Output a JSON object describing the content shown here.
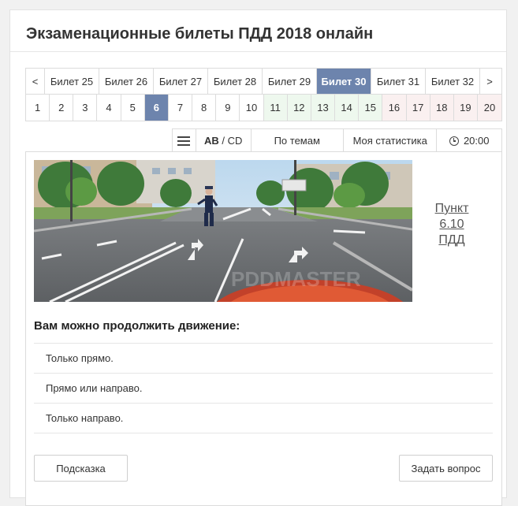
{
  "page": {
    "title": "Экзаменационные билеты ПДД 2018 онлайн"
  },
  "tickets": {
    "prev": "<",
    "next": ">",
    "items": [
      "Билет 25",
      "Билет 26",
      "Билет 27",
      "Билет 28",
      "Билет 29",
      "Билет 30",
      "Билет 31",
      "Билет 32"
    ],
    "active": "Билет 30"
  },
  "questions": {
    "items": [
      "1",
      "2",
      "3",
      "4",
      "5",
      "6",
      "7",
      "8",
      "9",
      "10",
      "11",
      "12",
      "13",
      "14",
      "15",
      "16",
      "17",
      "18",
      "19",
      "20"
    ],
    "active": "6"
  },
  "toolbar": {
    "menu_icon": "menu-icon",
    "category_bold": "AB",
    "category_sep": " / ",
    "category_rest": "CD",
    "topics": "По темам",
    "stats": "Моя статистика",
    "timer": "20:00",
    "timer_icon": "clock-icon"
  },
  "question": {
    "reference_line1": "Пункт",
    "reference_line2": "6.10",
    "reference_line3": "ПДД",
    "text": "Вам можно продолжить движение:",
    "answers": [
      "Только прямо.",
      "Прямо или направо.",
      "Только направо."
    ],
    "watermark": "PDDMASTER"
  },
  "buttons": {
    "hint": "Подсказка",
    "ask": "Задать вопрос"
  },
  "colors": {
    "accent": "#6d84ad",
    "answered_green": "#eef8ee",
    "answered_pink": "#faf0f0"
  }
}
